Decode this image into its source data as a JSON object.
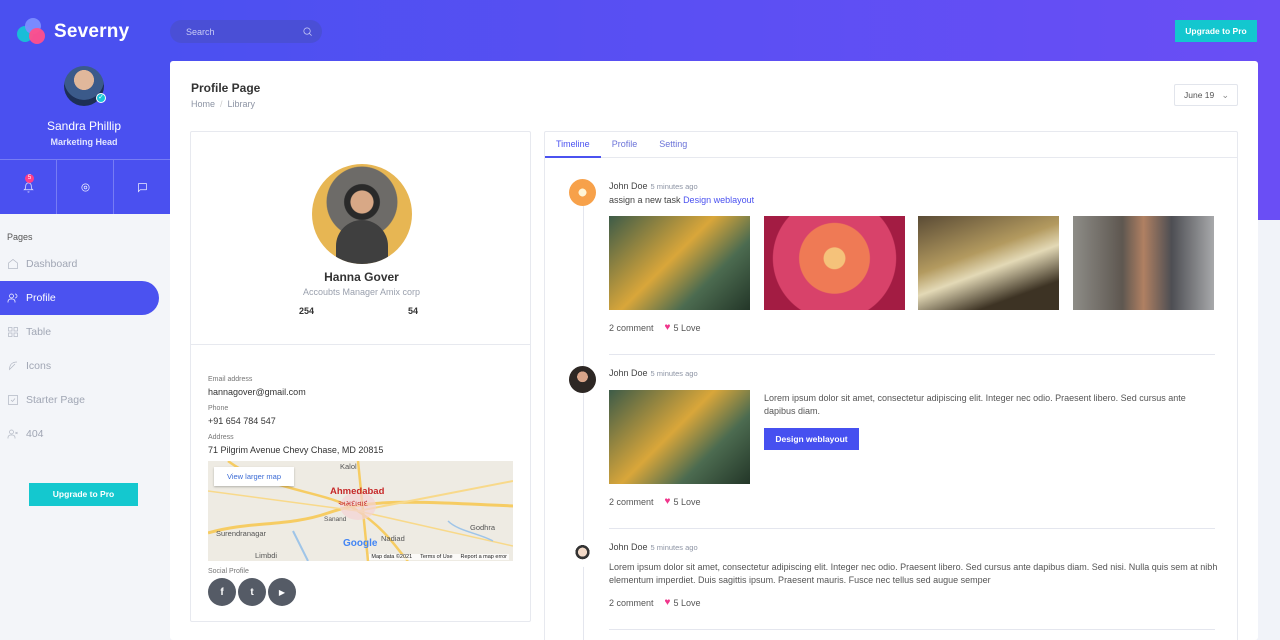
{
  "app": {
    "brand": "Severny"
  },
  "header": {
    "search_placeholder": "Search",
    "upgrade_label": "Upgrade to Pro"
  },
  "user": {
    "name": "Sandra Phillip",
    "role": "Marketing Head",
    "notification_count": "5"
  },
  "sidebar": {
    "section_title": "Pages",
    "items": [
      {
        "label": "Dashboard",
        "icon": "home-icon"
      },
      {
        "label": "Profile",
        "icon": "users-icon",
        "active": true
      },
      {
        "label": "Table",
        "icon": "grid-icon"
      },
      {
        "label": "Icons",
        "icon": "feather-icon"
      },
      {
        "label": "Starter Page",
        "icon": "checkbox-icon"
      },
      {
        "label": "404",
        "icon": "user-x-icon"
      }
    ],
    "upgrade_label": "Upgrade to Pro"
  },
  "page": {
    "title": "Profile Page",
    "breadcrumb": [
      "Home",
      "/",
      "Library"
    ],
    "date_select": "June 19"
  },
  "profile": {
    "name": "Hanna Gover",
    "job": "Accoubts Manager Amix corp",
    "stat_1": "254",
    "stat_2": "54",
    "email_label": "Email address",
    "email": "hannagover@gmail.com",
    "phone_label": "Phone",
    "phone": "+91 654 784 547",
    "address_label": "Address",
    "address": "71 Pilgrim Avenue Chevy Chase, MD 20815",
    "map": {
      "view_larger": "View larger map",
      "cities": [
        "Kalol",
        "Ahmedabad",
        "અમદાવાદ",
        "Sanand",
        "Surendranagar",
        "Nadiad",
        "Godhra",
        "Limbdi"
      ],
      "footer": [
        "Map data ©2021",
        "Terms of Use",
        "Report a map error"
      ],
      "logo": "Google"
    },
    "social_label": "Social Profile",
    "social": [
      "f",
      "t",
      "▶"
    ]
  },
  "tabs": [
    "Timeline",
    "Profile",
    "Setting"
  ],
  "timeline": [
    {
      "name": "John Doe",
      "time": "5 minutes ago",
      "text": "assign a new task",
      "link": "Design weblayout",
      "comments": "2 comment",
      "love": "5 Love"
    },
    {
      "name": "John Doe",
      "time": "5 minutes ago",
      "text": "Lorem ipsum dolor sit amet, consectetur adipiscing elit. Integer nec odio. Praesent libero. Sed cursus ante dapibus diam.",
      "button": "Design weblayout",
      "comments": "2 comment",
      "love": "5 Love"
    },
    {
      "name": "John Doe",
      "time": "5 minutes ago",
      "text": "Lorem ipsum dolor sit amet, consectetur adipiscing elit. Integer nec odio. Praesent libero. Sed cursus ante dapibus diam. Sed nisi. Nulla quis sem at nibh elementum imperdiet. Duis sagittis ipsum. Praesent mauris. Fusce nec tellus sed augue semper",
      "comments": "2 comment",
      "love": "5 Love"
    }
  ],
  "colors": {
    "primary": "#4b52f0",
    "accent": "#14c8cf",
    "heart": "#f0358b"
  }
}
